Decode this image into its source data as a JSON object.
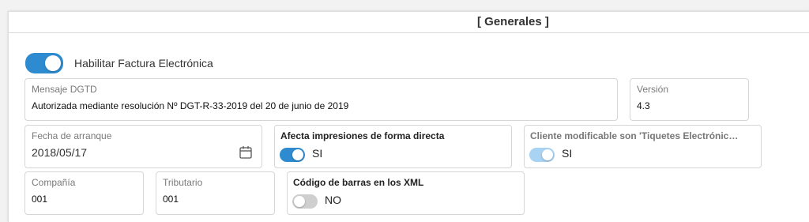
{
  "header": {
    "title": "[ Generales ]"
  },
  "einvoice": {
    "label": "Habilitar Factura Electrónica",
    "enabled": true
  },
  "fields": {
    "mensaje_dgtd": {
      "label": "Mensaje DGTD",
      "value": "Autorizada mediante resolución Nº DGT-R-33-2019 del 20 de junio de 2019"
    },
    "version": {
      "label": "Versión",
      "value": "4.3"
    },
    "fecha_arranque": {
      "label": "Fecha de arranque",
      "value": "2018/05/17"
    },
    "compania": {
      "label": "Compañía",
      "value": "001"
    },
    "tributario": {
      "label": "Tributario",
      "value": "001"
    }
  },
  "switches": {
    "afecta_impresiones": {
      "label": "Afecta impresiones de forma directa",
      "state": "SI",
      "enabled": true
    },
    "cliente_modificable": {
      "label": "Cliente modificable son 'Tiquetes Electrónicos'",
      "state": "SI",
      "enabled": true,
      "disabled": true
    },
    "codigo_barras": {
      "label": "Código de barras en los XML",
      "state": "NO",
      "enabled": false
    }
  },
  "icons": {
    "calendar": "calendar-icon"
  },
  "colors": {
    "accent": "#2e8bd0",
    "accent_disabled": "#a9d3f2",
    "off": "#cfcfcf"
  }
}
